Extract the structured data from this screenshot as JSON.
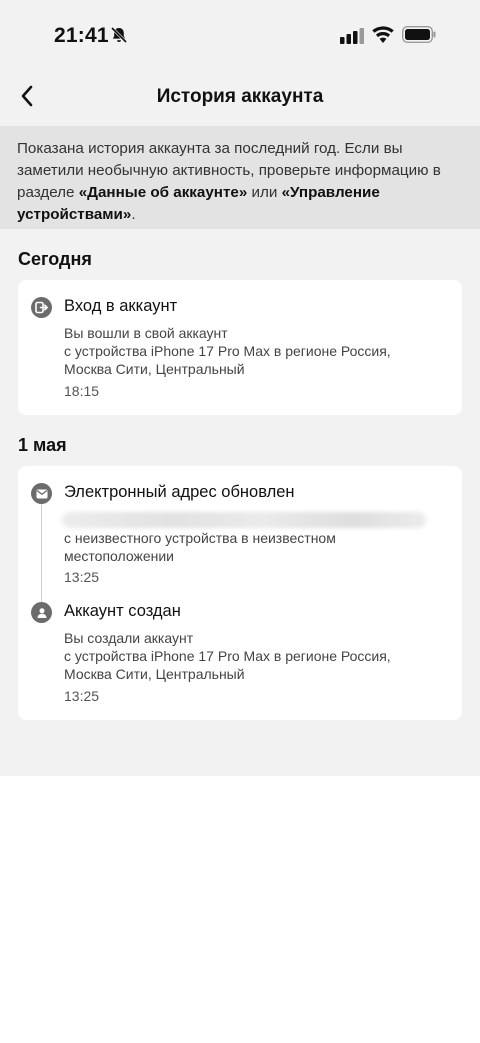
{
  "status_bar": {
    "time": "21:41"
  },
  "header": {
    "title": "История аккаунта"
  },
  "info": {
    "text_before": "Показана история аккаунта за последний год. Если вы заметили необычную активность, проверьте информацию в разделе ",
    "link_account_data": "«Данные об аккаунте»",
    "text_middle": " или ",
    "link_devices": "«Управление устройствами»",
    "text_after": "."
  },
  "sections": [
    {
      "title": "Сегодня",
      "events": [
        {
          "icon": "login-icon",
          "title": "Вход в аккаунт",
          "desc_lines": [
            "Вы вошли в свой аккаунт",
            "с устройства iPhone 17 Pro Max в регионе Россия,",
            "Москва Сити, Центральный"
          ],
          "time": "18:15"
        }
      ]
    },
    {
      "title": "1 мая",
      "events": [
        {
          "icon": "mail-icon",
          "title": "Электронный адрес обновлен",
          "desc_lines": [
            "с неизвестного устройства в неизвестном",
            "местоположении"
          ],
          "time": "13:25"
        },
        {
          "icon": "user-icon",
          "title": "Аккаунт создан",
          "desc_lines": [
            "Вы создали аккаунт",
            "с устройства iPhone 17 Pro Max в регионе Россия,",
            "Москва Сити, Центральный"
          ],
          "time": "13:25"
        }
      ]
    }
  ]
}
